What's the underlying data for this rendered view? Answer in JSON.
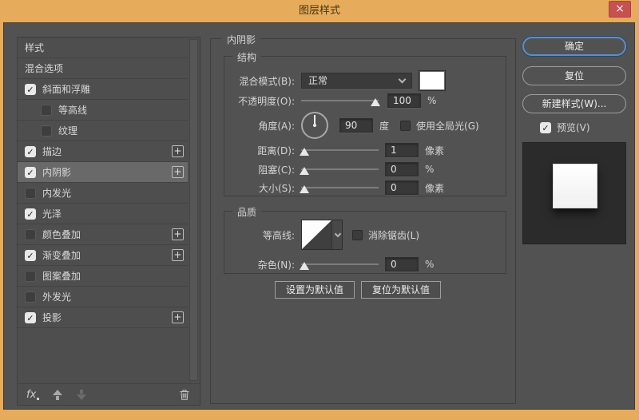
{
  "window": {
    "title": "图层样式"
  },
  "icons": {
    "close": "×",
    "check": "✓",
    "plus": "+",
    "trash": "trash-can",
    "fx": "fx-effects",
    "chevron": "chevron-down"
  },
  "colors": {
    "chrome": "#e7ac5b",
    "close_red": "#c75050",
    "panel": "#525252",
    "focus_ring": "#5d8fc4",
    "swatch": "#ffffff"
  },
  "sidebar": {
    "items": [
      {
        "label": "样式",
        "checkbox": null,
        "indent": false,
        "plus": false,
        "selected": false
      },
      {
        "label": "混合选项",
        "checkbox": null,
        "indent": false,
        "plus": false,
        "selected": false
      },
      {
        "label": "斜面和浮雕",
        "checkbox": true,
        "indent": false,
        "plus": false,
        "selected": false
      },
      {
        "label": "等高线",
        "checkbox": false,
        "indent": true,
        "plus": false,
        "selected": false
      },
      {
        "label": "纹理",
        "checkbox": false,
        "indent": true,
        "plus": false,
        "selected": false
      },
      {
        "label": "描边",
        "checkbox": true,
        "indent": false,
        "plus": true,
        "selected": false
      },
      {
        "label": "内阴影",
        "checkbox": true,
        "indent": false,
        "plus": true,
        "selected": true
      },
      {
        "label": "内发光",
        "checkbox": false,
        "indent": false,
        "plus": false,
        "selected": false
      },
      {
        "label": "光泽",
        "checkbox": true,
        "indent": false,
        "plus": false,
        "selected": false
      },
      {
        "label": "颜色叠加",
        "checkbox": false,
        "indent": false,
        "plus": true,
        "selected": false
      },
      {
        "label": "渐变叠加",
        "checkbox": true,
        "indent": false,
        "plus": true,
        "selected": false
      },
      {
        "label": "图案叠加",
        "checkbox": false,
        "indent": false,
        "plus": false,
        "selected": false
      },
      {
        "label": "外发光",
        "checkbox": false,
        "indent": false,
        "plus": false,
        "selected": false
      },
      {
        "label": "投影",
        "checkbox": true,
        "indent": false,
        "plus": true,
        "selected": false
      }
    ],
    "footer": {
      "fx_label": "fx"
    }
  },
  "main": {
    "pane_title": "内阴影",
    "structure": {
      "legend": "结构",
      "blend_mode": {
        "label": "混合模式(B):",
        "value": "正常",
        "swatch_color": "#ffffff"
      },
      "opacity": {
        "label": "不透明度(O):",
        "value": "100",
        "unit": "%",
        "thumb_percent": 96
      },
      "angle": {
        "label": "角度(A):",
        "value": "90",
        "unit": "度",
        "degrees": 90
      },
      "use_global_light": {
        "label": "使用全局光(G)",
        "checked": false
      },
      "distance": {
        "label": "距离(D):",
        "value": "1",
        "unit": "像素",
        "thumb_percent": 4
      },
      "choke": {
        "label": "阻塞(C):",
        "value": "0",
        "unit": "%",
        "thumb_percent": 4
      },
      "size": {
        "label": "大小(S):",
        "value": "0",
        "unit": "像素",
        "thumb_percent": 4
      }
    },
    "quality": {
      "legend": "品质",
      "contour": {
        "label": "等高线:"
      },
      "anti_alias": {
        "label": "消除锯齿(L)",
        "checked": false
      },
      "noise": {
        "label": "杂色(N):",
        "value": "0",
        "unit": "%",
        "thumb_percent": 4
      }
    },
    "default_buttons": {
      "make_default": "设置为默认值",
      "reset_default": "复位为默认值"
    }
  },
  "actions": {
    "ok": "确定",
    "reset": "复位",
    "new_style": "新建样式(W)...",
    "preview": {
      "label": "预览(V)",
      "checked": true
    }
  }
}
